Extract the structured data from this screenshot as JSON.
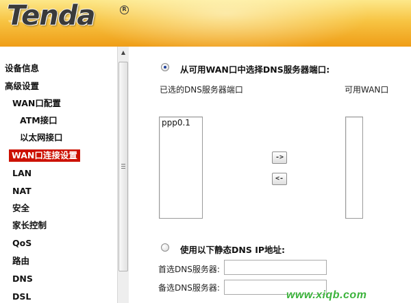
{
  "brand": {
    "logo_text": "Tenda",
    "registered_mark": "R"
  },
  "sidebar": {
    "items": [
      {
        "label": "设备信息",
        "level": 0,
        "active": false
      },
      {
        "label": "高级设置",
        "level": 0,
        "active": false
      },
      {
        "label": "WAN口配置",
        "level": 1,
        "active": false
      },
      {
        "label": "ATM接口",
        "level": 2,
        "active": false
      },
      {
        "label": "以太网接口",
        "level": 2,
        "active": false
      },
      {
        "label": "WAN口连接设置",
        "level": 1,
        "active": true
      },
      {
        "label": "LAN",
        "level": 1,
        "active": false
      },
      {
        "label": "NAT",
        "level": 1,
        "active": false
      },
      {
        "label": "安全",
        "level": 1,
        "active": false
      },
      {
        "label": "家长控制",
        "level": 1,
        "active": false
      },
      {
        "label": "QoS",
        "level": 1,
        "active": false
      },
      {
        "label": "路由",
        "level": 1,
        "active": false
      },
      {
        "label": "DNS",
        "level": 1,
        "active": false
      },
      {
        "label": "DSL",
        "level": 1,
        "active": false
      }
    ],
    "scroll_up_glyph": "▲"
  },
  "dns": {
    "option_wan_label": "从可用WAN口中选择DNS服务器端口:",
    "option_wan_selected": true,
    "selected_list_label": "已选的DNS服务器端口",
    "available_list_label": "可用WAN口",
    "selected_interfaces": [
      "ppp0.1"
    ],
    "available_interfaces": [],
    "move_right_label": "->",
    "move_left_label": "<-",
    "option_static_label": "使用以下静态DNS IP地址:",
    "option_static_selected": false,
    "primary_label": "首选DNS服务器:",
    "primary_value": "",
    "secondary_label": "备选DNS服务器:",
    "secondary_value": ""
  },
  "watermark": "www.xiqb.com",
  "colors": {
    "active_nav_bg": "#cc1100",
    "header_top": "#fde88a",
    "header_bottom": "#ef9d17",
    "watermark": "#3cb33c"
  }
}
